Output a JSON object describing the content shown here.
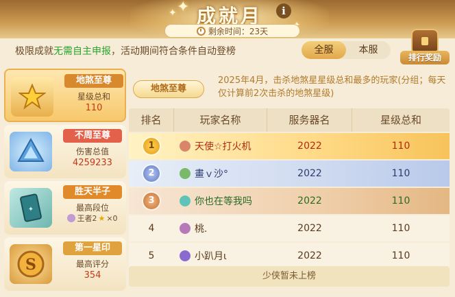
{
  "header": {
    "title": "成就月",
    "timer_text": "剩余时间：23天"
  },
  "subtitle": {
    "prefix": "极限成就",
    "highlight": "无需自主申报",
    "suffix": "，活动期间符合条件自动登榜"
  },
  "server_toggle": {
    "options": [
      "全服",
      "本服"
    ],
    "selected": "全服"
  },
  "rank_reward_label": "排行奖励",
  "categories": [
    {
      "name": "地煞至尊",
      "metric": "星级总和",
      "value": "110",
      "active": true,
      "name_color": "#d8892e"
    },
    {
      "name": "不周至尊",
      "metric": "伤害总值",
      "value": "4259233",
      "active": false,
      "name_color": "#e3614a"
    },
    {
      "name": "胜天半子",
      "metric": "最高段位",
      "value": "王者2",
      "value_suffix": "×0",
      "active": false,
      "name_color": "#e08a2a"
    },
    {
      "name": "第一星印",
      "metric": "最高评分",
      "value": "354",
      "active": false,
      "name_color": "#e0a23c"
    }
  ],
  "description": {
    "badge": "地煞至尊",
    "text": "2025年4月，击杀地煞星星级总和最多的玩家(分组；每天仅计算前2次击杀的地煞星级)"
  },
  "table": {
    "headers": [
      "排名",
      "玩家名称",
      "服务器名",
      "星级总和"
    ],
    "rows": [
      {
        "rank": "1",
        "name": "天使☆打火机",
        "server": "2022",
        "stars": "110",
        "avatar_color": "#d9856a"
      },
      {
        "rank": "2",
        "name": "畫ｖ沙°",
        "server": "2022",
        "stars": "110",
        "avatar_color": "#7ab86a"
      },
      {
        "rank": "3",
        "name": "你也在等我吗",
        "server": "2022",
        "stars": "110",
        "avatar_color": "#5fc4b8"
      },
      {
        "rank": "4",
        "name": "桃.",
        "server": "2022",
        "stars": "110",
        "avatar_color": "#b77ab8"
      },
      {
        "rank": "5",
        "name": "小趴月ι",
        "server": "2022",
        "stars": "110",
        "avatar_color": "#8a6ad0"
      }
    ]
  },
  "not_ranked_text": "少侠暂未上榜"
}
